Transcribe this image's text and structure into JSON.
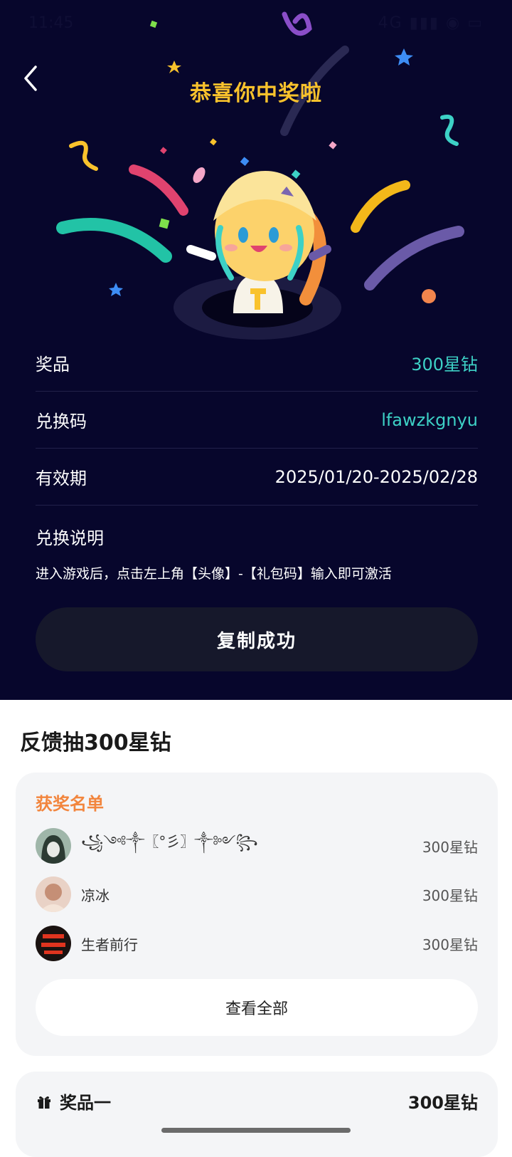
{
  "status_bar": {
    "time": "11:45",
    "icons": "4G ▮▮▮ ◉ ▭"
  },
  "header": {
    "title": "恭喜你中奖啦"
  },
  "info": {
    "prize_label": "奖品",
    "prize_value": "300星钻",
    "code_label": "兑换码",
    "code_value": "lfawzkgnyu",
    "validity_label": "有效期",
    "validity_value": "2025/01/20-2025/02/28",
    "desc_title": "兑换说明",
    "desc_text": "进入游戏后，点击左上角【头像】-【礼包码】输入即可激活"
  },
  "copy_button": "复制成功",
  "feedback": {
    "title": "反馈抽300星钻"
  },
  "winners": {
    "title": "获奖名单",
    "list": [
      {
        "name": "꧁༺༒〖°彡〗༒༻꧂",
        "prize": "300星钻"
      },
      {
        "name": "凉冰",
        "prize": "300星钻"
      },
      {
        "name": "生者前行",
        "prize": "300星钻"
      }
    ],
    "view_all": "查看全部"
  },
  "prize_item": {
    "label": "奖品一",
    "value": "300星钻"
  },
  "colors": {
    "background": "#07062c",
    "accent_cyan": "#3dd1c6",
    "title_gold": "#f9c22c",
    "winners_title": "#f2853d"
  }
}
